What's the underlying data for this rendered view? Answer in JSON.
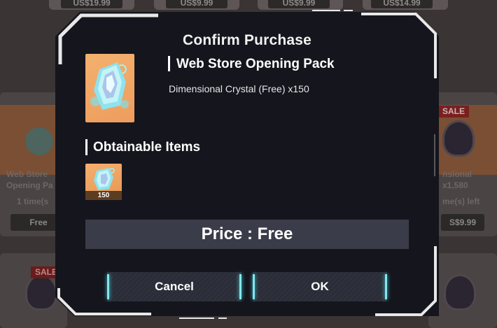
{
  "background": {
    "top_prices": [
      "US$19.99",
      "US$9.99",
      "US$9.99",
      "US$14.99"
    ],
    "left_card": {
      "name_line1": "Web Store",
      "name_line2": "Opening Pa",
      "limit": "1 time(s",
      "price": "Free"
    },
    "right_card": {
      "sale": "SALE",
      "name_line1": "nsional",
      "name_line2": "x1,580",
      "limit": "me(s) left",
      "price": "S$9.99"
    },
    "bottom_sale": "SALE"
  },
  "modal": {
    "title": "Confirm Purchase",
    "pack_name": "Web Store Opening Pack",
    "pack_desc": "Dimensional Crystal (Free) x150",
    "obtainable_heading": "Obtainable Items",
    "items": [
      {
        "icon": "dimensional-crystal-icon",
        "qty": "150"
      }
    ],
    "price_text": "Price : Free",
    "cancel_label": "Cancel",
    "ok_label": "OK"
  },
  "colors": {
    "modal_bg": "#15151d",
    "button_edge": "#7fe8ee",
    "thumb_orange": "#f2a766",
    "price_bar": "#3a3d49"
  }
}
